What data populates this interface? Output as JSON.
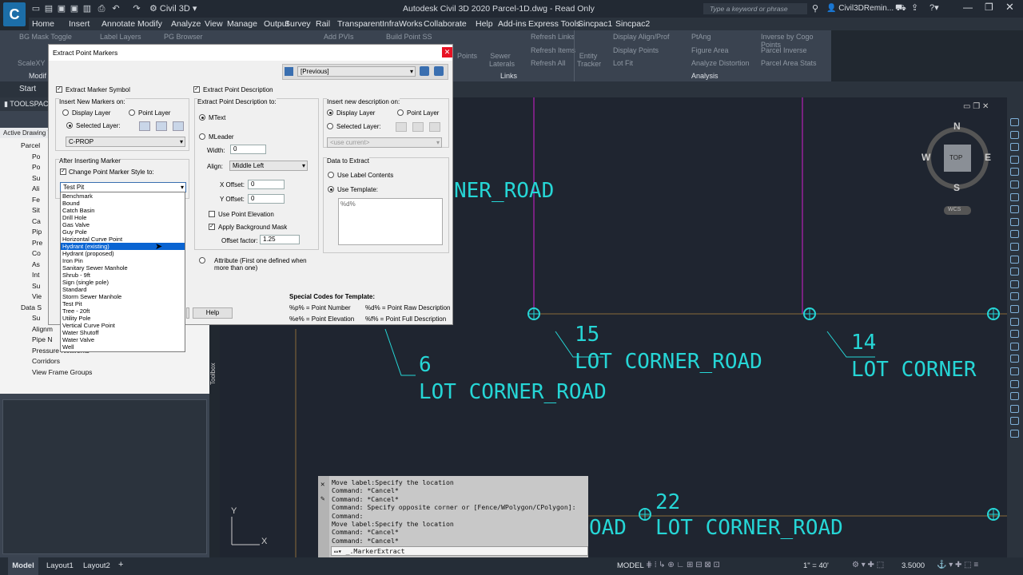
{
  "app": {
    "title": "Autodesk Civil 3D 2020   Parcel-1D.dwg - Read Only",
    "workspace": "Civil 3D",
    "search_placeholder": "Type a keyword or phrase",
    "user": "Civil3DRemin..."
  },
  "menu": [
    "Home",
    "Insert",
    "Annotate",
    "Modify",
    "Analyze",
    "View",
    "Manage",
    "Output",
    "Survey",
    "Rail",
    "Transparent",
    "InfraWorks",
    "Collaborate",
    "Help",
    "Add-ins",
    "Express Tools",
    "Sincpac1",
    "Sincpac2"
  ],
  "ribbon": {
    "items": [
      "BG Mask Toggle",
      "Label Layers",
      "PG Browser",
      "Add PVIs",
      "Build Point SS",
      "ScaleXY",
      "Refresh Links",
      "Refresh Items",
      "Refresh All",
      "Display Align/Prof",
      "Display Points",
      "Lot Fit",
      "PtAng",
      "Figure Area",
      "Analyze Distortion",
      "Inverse by Cogo Points",
      "Parcel Inverse",
      "Parcel Area Stats",
      "Sewer Laterals",
      "Entity Tracker",
      "Points"
    ],
    "panels": [
      "Links",
      "Analysis"
    ],
    "tab_start": "Start",
    "modify_label": "Modif"
  },
  "toolspace": {
    "title": "TOOLSPACE",
    "tab": "Active Drawing V",
    "tree": [
      "Parcel",
      "Po",
      "Po",
      "Su",
      "Ali",
      "Fe",
      "Sit",
      "Ca",
      "Pip",
      "Pre",
      "Co",
      "As",
      "Int",
      "Su",
      "Vie",
      "Data S",
      "Su",
      "Alignm",
      "Pipe N",
      "Pressure Networks",
      "Corridors",
      "View Frame Groups"
    ],
    "side_tab": "Toolbox"
  },
  "dialog": {
    "title": "Extract Point Markers",
    "preset": "[Previous]",
    "extract_marker_symbol": "Extract Marker Symbol",
    "insert_new_markers_on": "Insert New Markers on:",
    "display_layer": "Display Layer",
    "point_layer": "Point Layer",
    "selected_layer": "Selected Layer:",
    "layer_value": "C-PROP",
    "after_inserting_marker": "After Inserting Marker",
    "change_style": "Change Point Marker Style to:",
    "style_value": "Test Pit",
    "extract_point_description": "Extract Point Description",
    "extract_desc_to": "Extract Point Description to:",
    "mtext": "MText",
    "mleader": "MLeader",
    "width_label": "Width:",
    "width_value": "0",
    "align_label": "Align:",
    "align_value": "Middle Left",
    "xoffset_label": "X Offset:",
    "xoffset_value": "0",
    "yoffset_label": "Y Offset:",
    "yoffset_value": "0",
    "use_point_elevation": "Use Point Elevation",
    "apply_bg_mask": "Apply Background Mask",
    "offset_factor_label": "Offset factor:",
    "offset_factor_value": "1.25",
    "attribute": "Attribute (First one defined when more than one)",
    "insert_new_desc_on": "Insert new description on:",
    "use_current": "<use current>",
    "data_to_extract": "Data to Extract",
    "use_label_contents": "Use Label Contents",
    "use_template": "Use Template:",
    "template_value": "%d%",
    "special_codes_title": "Special Codes for Template:",
    "codes": [
      "%p% = Point Number",
      "%d% = Point Raw Description",
      "%e% = Point Elevation",
      "%f% = Point Full Description"
    ],
    "help": "Help"
  },
  "dropdown_items": [
    "Benchmark",
    "Bound",
    "Catch Basin",
    "Drill Hole",
    "Gas Valve",
    "Guy Pole",
    "Horizontal Curve Point",
    "Hydrant (existing)",
    "Hydrant (proposed)",
    "Iron Pin",
    "Sanitary Sewer Manhole",
    "Shrub - 9ft",
    "Sign (single pole)",
    "Standard",
    "Storm Sewer Manhole",
    "Test Pit",
    "Tree - 20ft",
    "Utility Pole",
    "Vertical Curve Point",
    "Water Shutoff",
    "Water Valve",
    "Well"
  ],
  "dropdown_selected_index": 7,
  "drawing": {
    "labels": [
      {
        "num": "15",
        "text": "LOT CORNER_ROAD"
      },
      {
        "num": "14",
        "text": "LOT CORNER"
      },
      {
        "num": "6",
        "text": "LOT CORNER_ROAD"
      },
      {
        "num": "22",
        "text": "LOT CORNER_ROAD"
      }
    ],
    "partial_top": "NER_ROAD",
    "partial_bottom": "OAD",
    "viewcube": {
      "n": "N",
      "s": "S",
      "e": "E",
      "w": "W",
      "top": "TOP",
      "wcs": "WCS"
    },
    "ucs": {
      "x": "X",
      "y": "Y"
    },
    "line_color": "#d020d0",
    "cyan": "#26d6d6"
  },
  "command": {
    "history": [
      "Move label:Specify the location",
      "Command: *Cancel*",
      "Command: *Cancel*",
      "Command: Specify opposite corner or [Fence/WPolygon/CPolygon]:",
      "Command:",
      "Move label:Specify the location",
      "Command: *Cancel*",
      "Command: *Cancel*"
    ],
    "input": "_.MarkerExtract"
  },
  "status": {
    "tabs": [
      "Model",
      "Layout1",
      "Layout2"
    ],
    "model": "MODEL",
    "scale": "1\" = 40'",
    "value": "3.5000"
  }
}
